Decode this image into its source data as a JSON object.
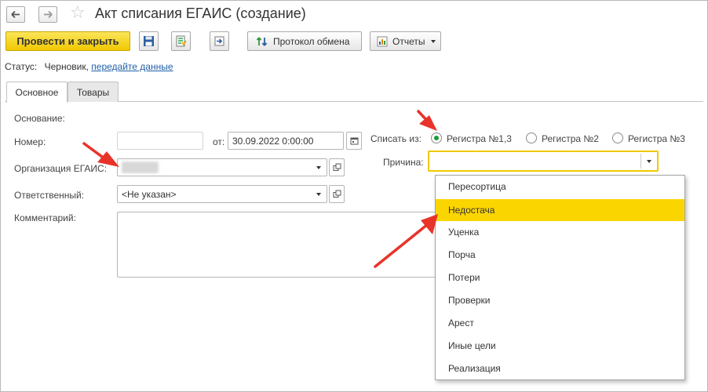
{
  "window": {
    "title": "Акт списания ЕГАИС (создание)"
  },
  "toolbar": {
    "post_close_label": "Провести и закрыть",
    "exchange_log_label": "Протокол обмена",
    "reports_label": "Отчеты"
  },
  "status": {
    "prefix": "Статус:",
    "value": "Черновик,",
    "link": "передайте данные"
  },
  "tabs": [
    {
      "label": "Основное",
      "active": true
    },
    {
      "label": "Товары",
      "active": false
    }
  ],
  "form": {
    "basis_label": "Основание:",
    "number_label": "Номер:",
    "number_value": "",
    "from_label": "от:",
    "date_value": "30.09.2022  0:00:00",
    "org_label": "Организация ЕГАИС:",
    "org_value": "",
    "responsible_label": "Ответственный:",
    "responsible_value": "<Не указан>",
    "comment_label": "Комментарий:",
    "comment_value": "",
    "writeoff_label": "Списать из:",
    "registers": [
      {
        "label": "Регистра №1,3",
        "checked": true
      },
      {
        "label": "Регистра №2",
        "checked": false
      },
      {
        "label": "Регистра №3",
        "checked": false
      }
    ],
    "reason_label": "Причина:",
    "reason_value": ""
  },
  "reason_options": [
    {
      "label": "Пересортица",
      "highlighted": false
    },
    {
      "label": "Недостача",
      "highlighted": true
    },
    {
      "label": "Уценка",
      "highlighted": false
    },
    {
      "label": "Порча",
      "highlighted": false
    },
    {
      "label": "Потери",
      "highlighted": false
    },
    {
      "label": "Проверки",
      "highlighted": false
    },
    {
      "label": "Арест",
      "highlighted": false
    },
    {
      "label": "Иные цели",
      "highlighted": false
    },
    {
      "label": "Реализация",
      "highlighted": false
    }
  ],
  "colors": {
    "primary_button": "#f1c800",
    "highlight": "#fbd500",
    "link": "#1f5fa8",
    "radio_dot": "#1e9a3b",
    "annotation_arrow": "#e8332a"
  }
}
